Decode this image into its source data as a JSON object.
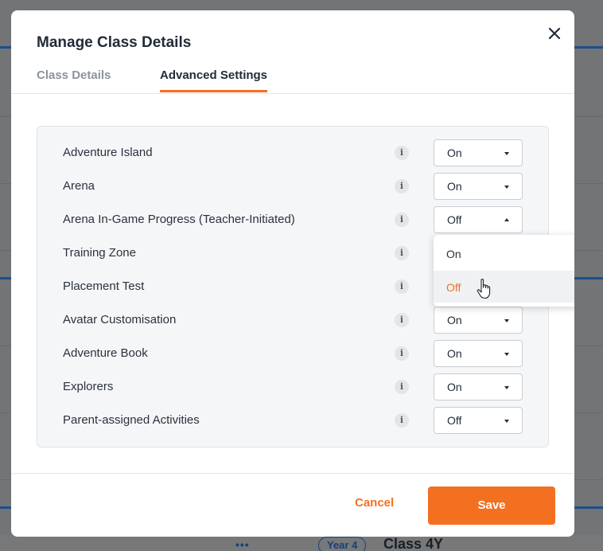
{
  "background": {
    "more_label": "•••",
    "year_badge": "Year 4",
    "class_name": "Class 4Y"
  },
  "modal": {
    "title": "Manage Class Details",
    "tabs": [
      {
        "label": "Class Details",
        "active": false
      },
      {
        "label": "Advanced Settings",
        "active": true
      }
    ],
    "settings": [
      {
        "label": "Adventure Island",
        "info": "i",
        "value": "On"
      },
      {
        "label": "Arena",
        "info": "i",
        "value": "On"
      },
      {
        "label": "Arena In-Game Progress (Teacher-Initiated)",
        "info": "i",
        "value": "Off",
        "open": true
      },
      {
        "label": "Training Zone",
        "info": "i",
        "value": ""
      },
      {
        "label": "Placement Test",
        "info": "i",
        "value": ""
      },
      {
        "label": "Avatar Customisation",
        "info": "i",
        "value": "On"
      },
      {
        "label": "Adventure Book",
        "info": "i",
        "value": "On"
      },
      {
        "label": "Explorers",
        "info": "i",
        "value": "On"
      },
      {
        "label": "Parent-assigned Activities",
        "info": "i",
        "value": "Off"
      }
    ],
    "dropdown_options": [
      {
        "label": "On",
        "highlighted": false
      },
      {
        "label": "Off",
        "highlighted": true
      }
    ],
    "cancel_label": "Cancel",
    "save_label": "Save"
  },
  "colors": {
    "accent": "#f37021",
    "text": "#222b38",
    "panel": "#f5f6f8"
  }
}
